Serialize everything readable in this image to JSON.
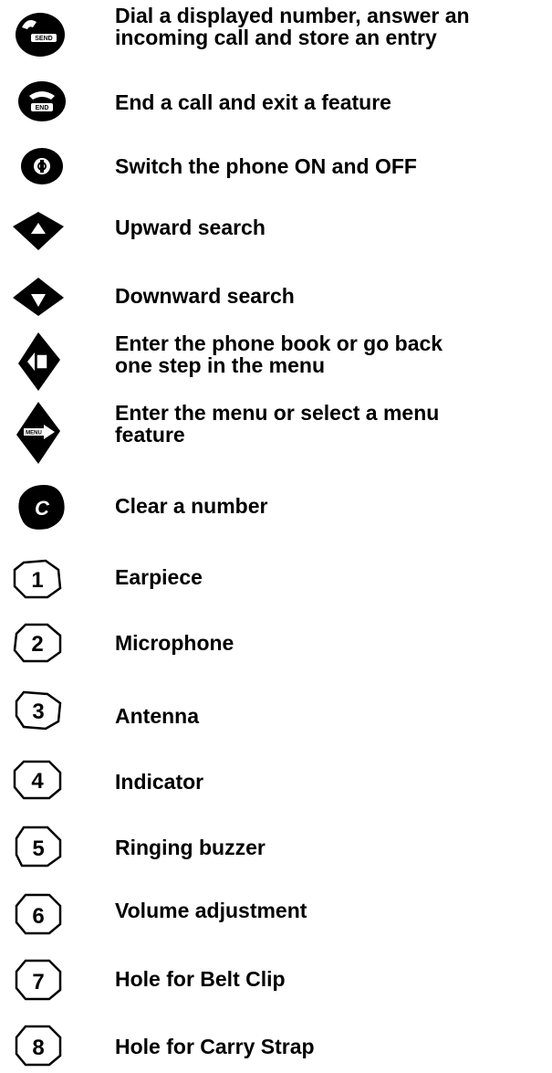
{
  "legend": [
    {
      "icon": "send-key-icon",
      "lines": [
        "Dial a displayed number, answer an",
        "incoming call and store an entry"
      ]
    },
    {
      "icon": "end-key-icon",
      "lines": [
        "End a call and exit a feature"
      ]
    },
    {
      "icon": "power-key-icon",
      "lines": [
        "Switch the phone ON and OFF"
      ]
    },
    {
      "icon": "up-key-icon",
      "lines": [
        "Upward search"
      ]
    },
    {
      "icon": "down-key-icon",
      "lines": [
        "Downward search"
      ]
    },
    {
      "icon": "phonebook-key-icon",
      "lines": [
        "Enter the phone book or go back",
        "one step in the menu"
      ]
    },
    {
      "icon": "menu-key-icon",
      "lines": [
        "Enter the menu or select a menu",
        "feature"
      ]
    },
    {
      "icon": "clear-key-icon",
      "lines": [
        "Clear a number"
      ]
    },
    {
      "icon": "callout-1-icon",
      "number": "1",
      "lines": [
        "Earpiece"
      ]
    },
    {
      "icon": "callout-2-icon",
      "number": "2",
      "lines": [
        "Microphone"
      ]
    },
    {
      "icon": "callout-3-icon",
      "number": "3",
      "lines": [
        "Antenna"
      ]
    },
    {
      "icon": "callout-4-icon",
      "number": "4",
      "lines": [
        "Indicator"
      ]
    },
    {
      "icon": "callout-5-icon",
      "number": "5",
      "lines": [
        "Ringing buzzer"
      ]
    },
    {
      "icon": "callout-6-icon",
      "number": "6",
      "lines": [
        "Volume adjustment"
      ]
    },
    {
      "icon": "callout-7-icon",
      "number": "7",
      "lines": [
        "Hole for Belt Clip"
      ]
    },
    {
      "icon": "callout-8-icon",
      "number": "8",
      "lines": [
        "Hole for Carry Strap"
      ]
    }
  ]
}
